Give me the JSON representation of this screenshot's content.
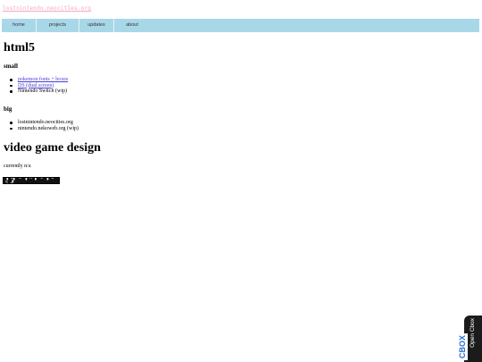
{
  "header": {
    "site_title": "lostnintendo.neocities.org",
    "heart_icon": "♡"
  },
  "nav": {
    "items": [
      {
        "label": "home"
      },
      {
        "label": "projects"
      },
      {
        "label": "updates"
      },
      {
        "label": "about"
      }
    ]
  },
  "html5": {
    "heading": "html5",
    "small": {
      "heading": "small",
      "items": [
        {
          "label": "pokemon fonts + boxes",
          "link": true
        },
        {
          "label": "DS (dual screen)",
          "link": true
        },
        {
          "label": "Nintendo Switch (wip)",
          "link": false
        }
      ]
    },
    "big": {
      "heading": "big",
      "items": [
        {
          "label": "lostnintendo.neocities.org",
          "link": false
        },
        {
          "label": "nintendo.nekoweb.org (wip)",
          "link": false
        }
      ]
    }
  },
  "vgd": {
    "heading": "video game design",
    "status": "currently n/a"
  },
  "banner": {
    "text": "▚ L▞ C ▚ K ▞ C ▚ G S ▞"
  },
  "cbox": {
    "label": "Open Cbox",
    "logo": "CBOX"
  },
  "colors": {
    "nav_bg": "#a8d8e8",
    "link": "#4a3cd6",
    "logo": "#f3a6c4"
  }
}
